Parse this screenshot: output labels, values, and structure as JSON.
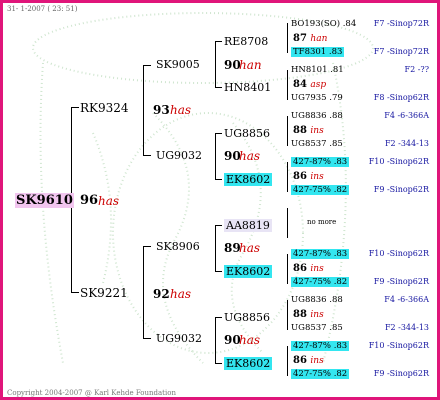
{
  "header": "31- 1-2007 ( 23: 51)",
  "footer": "Copyright 2004-2007 @ Karl Kehde Foundation",
  "subject": {
    "ring": "SK9610",
    "score": "96",
    "note": "has"
  },
  "sire": {
    "ring": "RK9324",
    "score": "93",
    "note": "has"
  },
  "dam": {
    "ring": "SK9221",
    "score": "92",
    "note": "has"
  },
  "ss": {
    "ring": "SK9005",
    "score": "90",
    "note": "han"
  },
  "sd": {
    "ring": "UG9032",
    "score": "90",
    "note": "has"
  },
  "ds": {
    "ring": "SK8906",
    "score": "89",
    "note": "has"
  },
  "dd": {
    "ring": "UG9032",
    "score": "90",
    "note": "has"
  },
  "g3": [
    {
      "ring": "RE8708"
    },
    {
      "ring": "HN8401"
    },
    {
      "ring": "UG8856"
    },
    {
      "ring": "EK8602"
    },
    {
      "ring": "AA8819"
    },
    {
      "ring": "EK8602"
    },
    {
      "ring": "UG8856"
    },
    {
      "ring": "EK8602"
    }
  ],
  "g4": [
    {
      "top": "BO193(SO) .84",
      "score": "87",
      "note": "han",
      "bottom": "TF8301 .83",
      "bottom_hl": true
    },
    {
      "top": "HN8101 .81",
      "score": "84",
      "note": "asp",
      "bottom": "UG7935 .79",
      "bottom_hl": false
    },
    {
      "top": "UG8836 .88",
      "score": "88",
      "note": "ins",
      "bottom": "UG8537 .85",
      "bottom_hl": false
    },
    {
      "top": "427-87% .83",
      "score": "86",
      "note": "ins",
      "bottom": "427-75% .82",
      "bottom_hl": true,
      "top_hl": true
    },
    {
      "nomore": "no more"
    },
    {
      "top": "427-87% .83",
      "score": "86",
      "note": "ins",
      "bottom": "427-75% .82",
      "bottom_hl": true,
      "top_hl": true
    },
    {
      "top": "UG8836 .88",
      "score": "88",
      "note": "ins",
      "bottom": "UG8537 .85",
      "bottom_hl": false
    },
    {
      "top": "427-87% .83",
      "score": "86",
      "note": "ins",
      "bottom": "427-75% .82",
      "bottom_hl": true,
      "top_hl": true
    }
  ],
  "origins": [
    "F7 -Sinop72R",
    "F7 -Sinop72R",
    "F2 -??",
    "F8 -Sinop62R",
    "F4 -6-366A",
    "F2 -344-13",
    "F10 -Sinop62R",
    "F9 -Sinop62R",
    "",
    "",
    "F10 -Sinop62R",
    "F9 -Sinop62R",
    "F4 -6-366A",
    "F2 -344-13",
    "F10 -Sinop62R",
    "F9 -Sinop62R"
  ]
}
